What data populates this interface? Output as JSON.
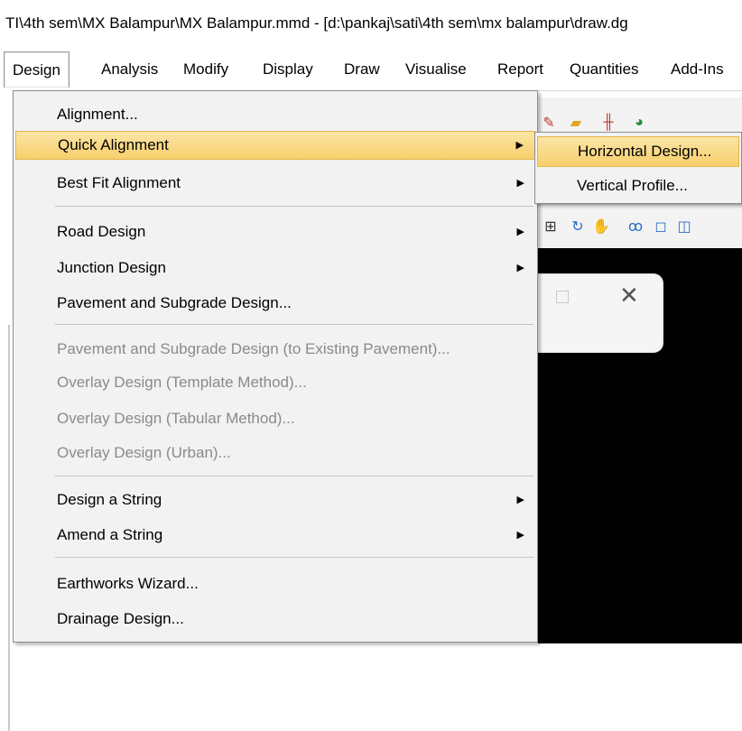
{
  "window": {
    "title": "TI\\4th sem\\MX Balampur\\MX Balampur.mmd - [d:\\pankaj\\sati\\4th sem\\mx balampur\\draw.dg"
  },
  "menubar": {
    "items": [
      {
        "label": "Design",
        "active": true
      },
      {
        "label": "Analysis"
      },
      {
        "label": "Modify"
      },
      {
        "label": "Display"
      },
      {
        "label": "Draw"
      },
      {
        "label": "Visualise"
      },
      {
        "label": "Report"
      },
      {
        "label": "Quantities"
      },
      {
        "label": "Add-Ins"
      }
    ]
  },
  "design_menu": {
    "items": [
      {
        "label": "Alignment...",
        "enabled": true,
        "submenu": false
      },
      {
        "label": "Quick Alignment",
        "enabled": true,
        "submenu": true,
        "highlighted": true
      },
      {
        "label": "Best Fit Alignment",
        "enabled": true,
        "submenu": true
      },
      {
        "label": "Road Design",
        "enabled": true,
        "submenu": true
      },
      {
        "label": "Junction Design",
        "enabled": true,
        "submenu": true
      },
      {
        "label": "Pavement and Subgrade Design...",
        "enabled": true,
        "submenu": false
      },
      {
        "label": "Pavement and Subgrade Design (to Existing Pavement)...",
        "enabled": false,
        "submenu": false
      },
      {
        "label": "Overlay Design (Template Method)...",
        "enabled": false,
        "submenu": false
      },
      {
        "label": "Overlay Design (Tabular Method)...",
        "enabled": false,
        "submenu": false
      },
      {
        "label": "Overlay Design (Urban)...",
        "enabled": false,
        "submenu": false
      },
      {
        "label": "Design a String",
        "enabled": true,
        "submenu": true
      },
      {
        "label": "Amend a String",
        "enabled": true,
        "submenu": true
      },
      {
        "label": "Earthworks Wizard...",
        "enabled": true,
        "submenu": false
      },
      {
        "label": "Drainage Design...",
        "enabled": true,
        "submenu": false
      }
    ],
    "arrow_glyph": "▶"
  },
  "quick_alignment_submenu": {
    "items": [
      {
        "label": "Horizontal Design...",
        "highlighted": true
      },
      {
        "label": "Vertical Profile..."
      }
    ]
  },
  "dialog": {
    "close_glyph": "✕"
  },
  "colors": {
    "highlight_top": "#fbe5a6",
    "highlight_bottom": "#f7cf6c",
    "menu_bg": "#f2f2f2",
    "disabled_text": "#8a8a8a",
    "canvas": "#000000"
  }
}
